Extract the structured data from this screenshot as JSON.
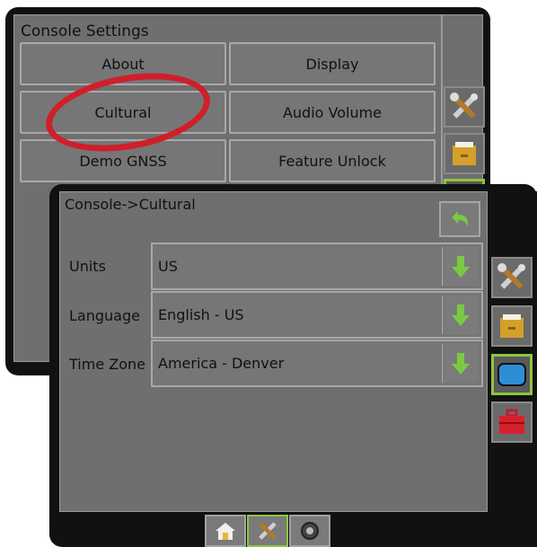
{
  "console_settings": {
    "title": "Console Settings",
    "buttons": {
      "about": "About",
      "display": "Display",
      "cultural": "Cultural",
      "audio_volume": "Audio Volume",
      "demo_gnss": "Demo GNSS",
      "feature_unlock": "Feature Unlock"
    }
  },
  "cultural": {
    "breadcrumb": "Console->Cultural",
    "rows": [
      {
        "label": "Units",
        "value": "US"
      },
      {
        "label": "Language",
        "value": "English - US"
      },
      {
        "label": "Time Zone",
        "value": "America - Denver"
      }
    ]
  },
  "colors": {
    "panel": "#6f6f6f",
    "annotation": "#cf1f2a",
    "accent_green": "#8cc63f",
    "dropdown_arrow": "#7ac943"
  },
  "icons": [
    "tools-icon",
    "folder-icon",
    "console-icon",
    "toolbox-icon",
    "home-icon",
    "camera-icon",
    "back-arrow-icon",
    "down-arrow-icon"
  ]
}
